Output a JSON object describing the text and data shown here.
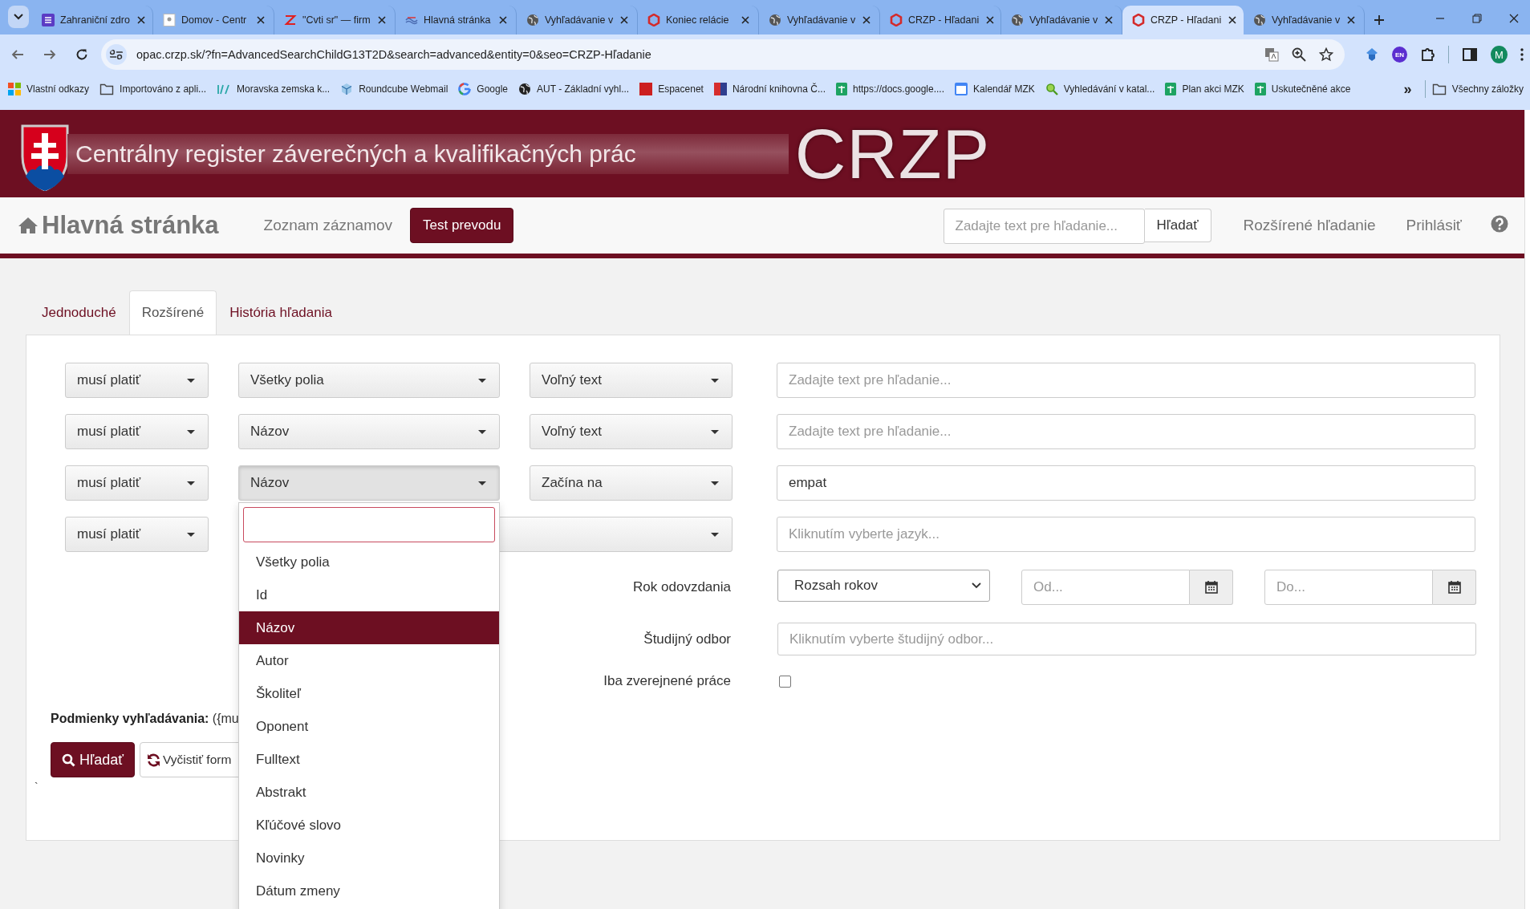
{
  "browser": {
    "tabs": [
      {
        "title": "Zahraniční zdro",
        "kind": "list",
        "selected": false
      },
      {
        "title": "Domov - Centr",
        "kind": "page",
        "selected": false
      },
      {
        "title": "\"Cvti sr\" — firm",
        "kind": "zigzag",
        "selected": false
      },
      {
        "title": "Hlavná stránka",
        "kind": "waves",
        "selected": false
      },
      {
        "title": "Vyhľadávanie v",
        "kind": "globe",
        "selected": false
      },
      {
        "title": "Koniec relácie",
        "kind": "hexagon",
        "selected": false
      },
      {
        "title": "Vyhľadávanie v",
        "kind": "globe",
        "selected": false
      },
      {
        "title": "CRZP - Hľadani",
        "kind": "hexagon",
        "selected": false
      },
      {
        "title": "Vyhľadávanie v",
        "kind": "globe",
        "selected": false
      },
      {
        "title": "CRZP - Hľadani",
        "kind": "hexagon",
        "selected": true
      },
      {
        "title": "Vyhľadávanie v",
        "kind": "globe",
        "selected": false
      }
    ],
    "url": "opac.crzp.sk/?fn=AdvancedSearchChildG13T2D&search=advanced&entity=0&seo=CRZP-Hľadanie",
    "extension_badge": "EN",
    "profile_initial": "M",
    "bookmarks": [
      {
        "label": "Vlastní odkazy",
        "kind": "tiles"
      },
      {
        "label": "Importováno z apli...",
        "kind": "folder"
      },
      {
        "label": "Moravska zemska k...",
        "kind": "slashes"
      },
      {
        "label": "Roundcube Webmail",
        "kind": "cube"
      },
      {
        "label": "Google",
        "kind": "ring"
      },
      {
        "label": "AUT - Základní vyhl...",
        "kind": "globe"
      },
      {
        "label": "Espacenet",
        "kind": "square"
      },
      {
        "label": "Národní knihovna Č...",
        "kind": "split"
      },
      {
        "label": "https://docs.google....",
        "kind": "sheet"
      },
      {
        "label": "Kalendář MZK",
        "kind": "calendar"
      },
      {
        "label": "Vyhledávání v katal...",
        "kind": "magnifier"
      },
      {
        "label": "Plan akci MZK",
        "kind": "sheet"
      },
      {
        "label": "Uskutečněné akce",
        "kind": "sheet"
      }
    ],
    "bookmarks_more": "»",
    "all_bookmarks": "Všechny záložky"
  },
  "header": {
    "title": "Centrálny register záverečných a kvalifikačných prác",
    "logo_text": "CRZP"
  },
  "nav": {
    "home": "Hlavná stránka",
    "links": [
      "Zoznam záznamov"
    ],
    "button": "Test prevodu",
    "search": {
      "placeholder": "Zadajte text pre hľadanie...",
      "button": "Hľadať"
    },
    "right_links": [
      "Rozšírené hľadanie",
      "Prihlásiť"
    ]
  },
  "tabs": [
    {
      "label": "Jednoduché",
      "selected": false
    },
    {
      "label": "Rozšírené",
      "selected": true
    },
    {
      "label": "História hľadania",
      "selected": false
    }
  ],
  "rows": [
    {
      "mode": "musí platiť",
      "field": "Všetky polia",
      "match": "Voľný text",
      "placeholder": "Zadajte text pre hľadanie...",
      "open": false
    },
    {
      "mode": "musí platiť",
      "field": "Názov",
      "match": "Voľný text",
      "placeholder": "Zadajte text pre hľadanie...",
      "open": false
    },
    {
      "mode": "musí platiť",
      "field": "Názov",
      "match": "Začína na",
      "value": "empat",
      "open": true
    },
    {
      "mode": "musí platiť",
      "placeholder": "Kliknutím vyberte jazyk...",
      "open": false
    }
  ],
  "dropdown": {
    "items": [
      {
        "label": "Všetky polia",
        "selected": false
      },
      {
        "label": "Id",
        "selected": false
      },
      {
        "label": "Názov",
        "selected": true
      },
      {
        "label": "Autor",
        "selected": false
      },
      {
        "label": "Školiteľ",
        "selected": false
      },
      {
        "label": "Oponent",
        "selected": false
      },
      {
        "label": "Fulltext",
        "selected": false
      },
      {
        "label": "Abstrakt",
        "selected": false
      },
      {
        "label": "Kľúčové slovo",
        "selected": false
      },
      {
        "label": "Novinky",
        "selected": false
      },
      {
        "label": "Dátum zmeny",
        "selected": false
      }
    ]
  },
  "year": {
    "label": "Rok odovzdania",
    "select": "Rozsah rokov",
    "from_placeholder": "Od...",
    "to_placeholder": "Do..."
  },
  "study": {
    "label": "Študijný odbor",
    "placeholder": "Kliknutím vyberte študijný odbor..."
  },
  "published": {
    "label": "Iba zverejnené práce",
    "checked": false
  },
  "conditions": {
    "label": "Podmienky vyhľadávania:",
    "value": "({mu"
  },
  "buttons": [
    {
      "label": "Hľadať",
      "kind": "primary"
    },
    {
      "label": "Vyčistiť form",
      "kind": "reset"
    }
  ],
  "stray_mark": "`"
}
